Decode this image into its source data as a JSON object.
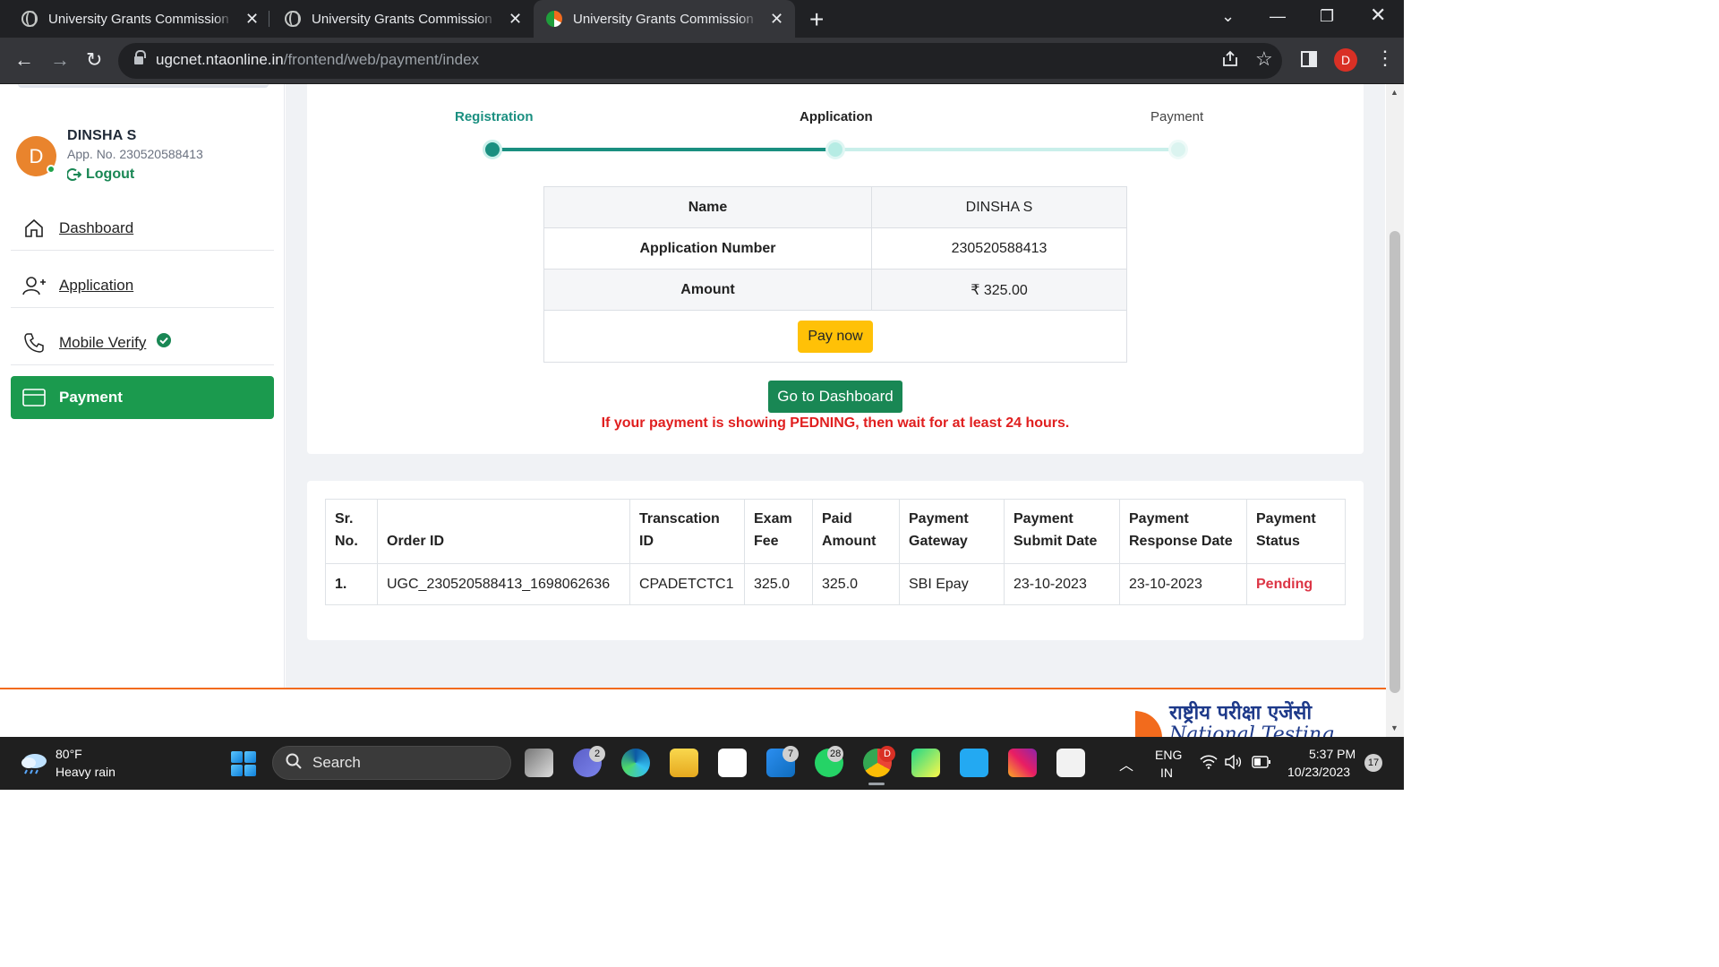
{
  "browser": {
    "tabs": [
      {
        "title": "University Grants Commission (UGC)",
        "icon": "globe-icon"
      },
      {
        "title": "University Grants Commission (UGC)",
        "icon": "globe-icon"
      },
      {
        "title": "University Grants Commission (UGC)",
        "icon": "nta-icon",
        "active": true
      }
    ],
    "url_host": "ugcnet.ntaonline.in",
    "url_path": "/frontend/web/payment/index",
    "profile_initial": "D"
  },
  "sidebar": {
    "avatar_initial": "D",
    "user_name": "DINSHA S",
    "app_no": "App. No. 230520588413",
    "logout_label": "Logout",
    "items": [
      {
        "label": "Dashboard",
        "icon": "home-icon"
      },
      {
        "label": "Application",
        "icon": "user-plus-icon"
      },
      {
        "label": "Mobile Verify",
        "icon": "phone-icon",
        "verified": true
      },
      {
        "label": "Payment",
        "icon": "card-icon",
        "active": true
      }
    ]
  },
  "steps": [
    {
      "label": "Registration",
      "state": "done"
    },
    {
      "label": "Application",
      "state": "current"
    },
    {
      "label": "Payment",
      "state": "pending"
    }
  ],
  "summary": {
    "name_label": "Name",
    "name_value": "DINSHA S",
    "appno_label": "Application Number",
    "appno_value": "230520588413",
    "amount_label": "Amount",
    "amount_value": "₹ 325.00",
    "pay_button": "Pay now"
  },
  "dashboard_button": "Go to Dashboard",
  "warning": "If your payment is showing PEDNING, then wait for at least 24 hours.",
  "payments": {
    "headers": [
      "Sr. No.",
      "Order ID",
      "Transcation ID",
      "Exam Fee",
      "Paid Amount",
      "Payment Gateway",
      "Payment Submit Date",
      "Payment Response Date",
      "Payment Status"
    ],
    "rows": [
      [
        "1.",
        "UGC_230520588413_1698062636",
        "CPADETCTC1",
        "325.0",
        "325.0",
        "SBI Epay",
        "23-10-2023",
        "23-10-2023",
        "Pending"
      ]
    ]
  },
  "footer": {
    "logo_hindi": "राष्ट्रीय परीक्षा एजेंसी",
    "logo_english": "National Testing Agency"
  },
  "taskbar": {
    "weather_temp": "80°F",
    "weather_desc": "Heavy rain",
    "search_label": "Search",
    "badges": {
      "teams": "2",
      "mail": "7",
      "whatsapp": "28",
      "chrome": "D"
    },
    "lang_1": "ENG",
    "lang_2": "IN",
    "time": "5:37 PM",
    "date": "10/23/2023",
    "notifications": "17"
  },
  "colors": {
    "accent_green": "#198754",
    "step_teal": "#1a8f80",
    "warning_red": "#e01f1f",
    "pay_yellow": "#ffc107",
    "nta_orange": "#f26b1d"
  }
}
